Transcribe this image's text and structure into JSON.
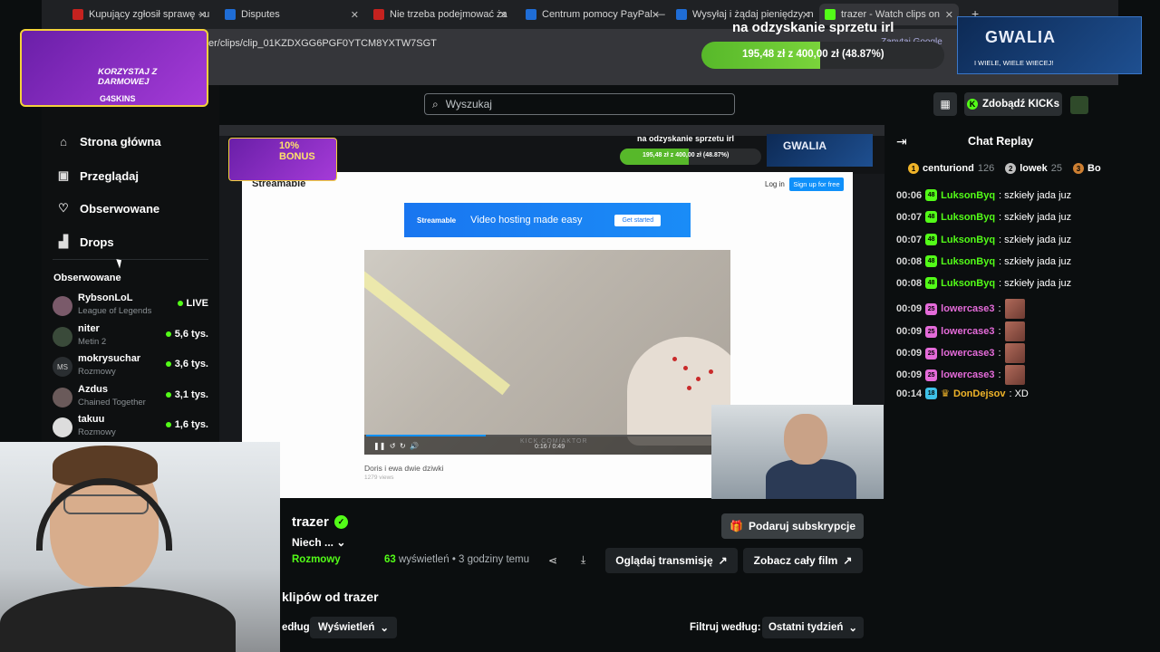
{
  "browser": {
    "tabs": [
      {
        "label": "Kupujący zgłosił sprawę - u",
        "fav_color": "#c5221f"
      },
      {
        "label": "Disputes",
        "fav_color": "#1f6dd6"
      },
      {
        "label": "Nie trzeba podejmować ża",
        "fav_color": "#c5221f"
      },
      {
        "label": "Centrum pomocy PayPal —",
        "fav_color": "#1f6dd6"
      },
      {
        "label": "Wysyłaj i żądaj pieniędzy, n",
        "fav_color": "#1f6dd6"
      },
      {
        "label": "trazer - Watch clips on",
        "fav_color": "#53fc18"
      }
    ],
    "url": "er/clips/clip_01KZDXGG6PGF0YTCM8YXTW7SGT",
    "google_btn": "Zapytaj Google"
  },
  "overlays": {
    "left_promo": "KORZYSTAJ Z DARMOWEJ",
    "left_brand": "G4SKINS",
    "goal_heading": "na odzyskanie sprzetu irl",
    "goal_amount": "195,48 zł z 400,00 zł (48.87%)",
    "goal_fraction": 0.4887,
    "right_logo": "GWALIA",
    "right_sub": "I WIELE, WIELE WIECEJ!",
    "inner_bonus": "10% BONUS",
    "inner_goal_heading": "na odzyskanie sprzetu irl",
    "inner_goal_amount": "195,48 zł z 400,00 zł (48.87%)",
    "inner_right_logo": "GWALIA"
  },
  "header": {
    "search_placeholder": "Wyszukaj",
    "kicks_label": "Zdobądź KICKs"
  },
  "sidebar": {
    "nav": [
      {
        "label": "Strona główna",
        "icon": "home-icon"
      },
      {
        "label": "Przeglądaj",
        "icon": "browse-icon"
      },
      {
        "label": "Obserwowane",
        "icon": "heart-icon"
      },
      {
        "label": "Drops",
        "icon": "drops-icon"
      }
    ],
    "section_title": "Obserwowane",
    "channels": [
      {
        "name": "RybsonLoL",
        "category": "League of Legends",
        "viewers": "LIVE"
      },
      {
        "name": "niter",
        "category": "Metin 2",
        "viewers": "5,6 tys."
      },
      {
        "name": "mokrysuchar",
        "category": "Rozmowy",
        "viewers": "3,6 tys.",
        "initials": "MS"
      },
      {
        "name": "Azdus",
        "category": "Chained Together",
        "viewers": "3,1 tys."
      },
      {
        "name": "takuu",
        "category": "Rozmowy",
        "viewers": "1,6 tys."
      }
    ]
  },
  "player": {
    "streamable": {
      "logo": "Streamable",
      "login": "Log in",
      "signup": "Sign up for free",
      "banner_brand": "Streamable",
      "banner_text": "Video hosting made easy",
      "banner_cta": "Get started",
      "caption": "Doris i ewa dwie dziwki",
      "views": "1279 views",
      "time": "0:16 / 0:49",
      "watermark": "KICK.COM/AKTOR",
      "progress": 0.33
    }
  },
  "clip": {
    "streamer": "trazer",
    "title": "Niech ...",
    "category": "Rozmowy",
    "views_count": "63",
    "views_suffix": "wyświetleń",
    "time_ago": "• 3 godziny temu",
    "watch_stream": "Oglądaj transmisję",
    "full_video": "Zobacz cały film",
    "gift_sub": "Podaruj subskrypcje"
  },
  "clips_section": {
    "title": "klipów od trazer",
    "sort_label": "edług:",
    "sort_value": "Wyświetleń",
    "filter_label": "Filtruj według:",
    "filter_value": "Ostatni tydzień"
  },
  "chat": {
    "title": "Chat Replay",
    "leaderboard": [
      {
        "rank": "1",
        "name": "centuriond",
        "points": "126",
        "color": "#f0b429"
      },
      {
        "rank": "2",
        "name": "lowek",
        "points": "25",
        "color": "#c0c0c0"
      },
      {
        "rank": "3",
        "name": "Bo",
        "points": "",
        "color": "#cd7f32"
      }
    ],
    "messages": [
      {
        "time": "00:06",
        "badge": "48",
        "user": "LuksonByq",
        "text": ": szkieły jada juz",
        "color": "#53fc18",
        "badge_color": "#53fc18"
      },
      {
        "time": "00:07",
        "badge": "48",
        "user": "LuksonByq",
        "text": ": szkieły jada juz",
        "color": "#53fc18",
        "badge_color": "#53fc18"
      },
      {
        "time": "00:07",
        "badge": "48",
        "user": "LuksonByq",
        "text": ": szkieły jada juz",
        "color": "#53fc18",
        "badge_color": "#53fc18"
      },
      {
        "time": "00:08",
        "badge": "48",
        "user": "LuksonByq",
        "text": ": szkieły jada juz",
        "color": "#53fc18",
        "badge_color": "#53fc18"
      },
      {
        "time": "00:08",
        "badge": "48",
        "user": "LuksonByq",
        "text": ": szkieły jada juz",
        "color": "#53fc18",
        "badge_color": "#53fc18"
      },
      {
        "time": "00:09",
        "badge": "25",
        "user": "lowercase3",
        "text": ":",
        "color": "#e46bd9",
        "badge_color": "#e46bd9",
        "emote": true
      },
      {
        "time": "00:09",
        "badge": "25",
        "user": "lowercase3",
        "text": ":",
        "color": "#e46bd9",
        "badge_color": "#e46bd9",
        "emote": true
      },
      {
        "time": "00:09",
        "badge": "25",
        "user": "lowercase3",
        "text": ":",
        "color": "#e46bd9",
        "badge_color": "#e46bd9",
        "emote": true
      },
      {
        "time": "00:09",
        "badge": "25",
        "user": "lowercase3",
        "text": ":",
        "color": "#e46bd9",
        "badge_color": "#e46bd9",
        "emote": true
      },
      {
        "time": "00:14",
        "badge": "18",
        "user": "DonDejsov",
        "text": ": XD",
        "color": "#f0b429",
        "badge_color": "#3ec1e8",
        "crown": true
      }
    ]
  },
  "colors": {
    "accent": "#53fc18",
    "background": "#0b0e0f"
  }
}
